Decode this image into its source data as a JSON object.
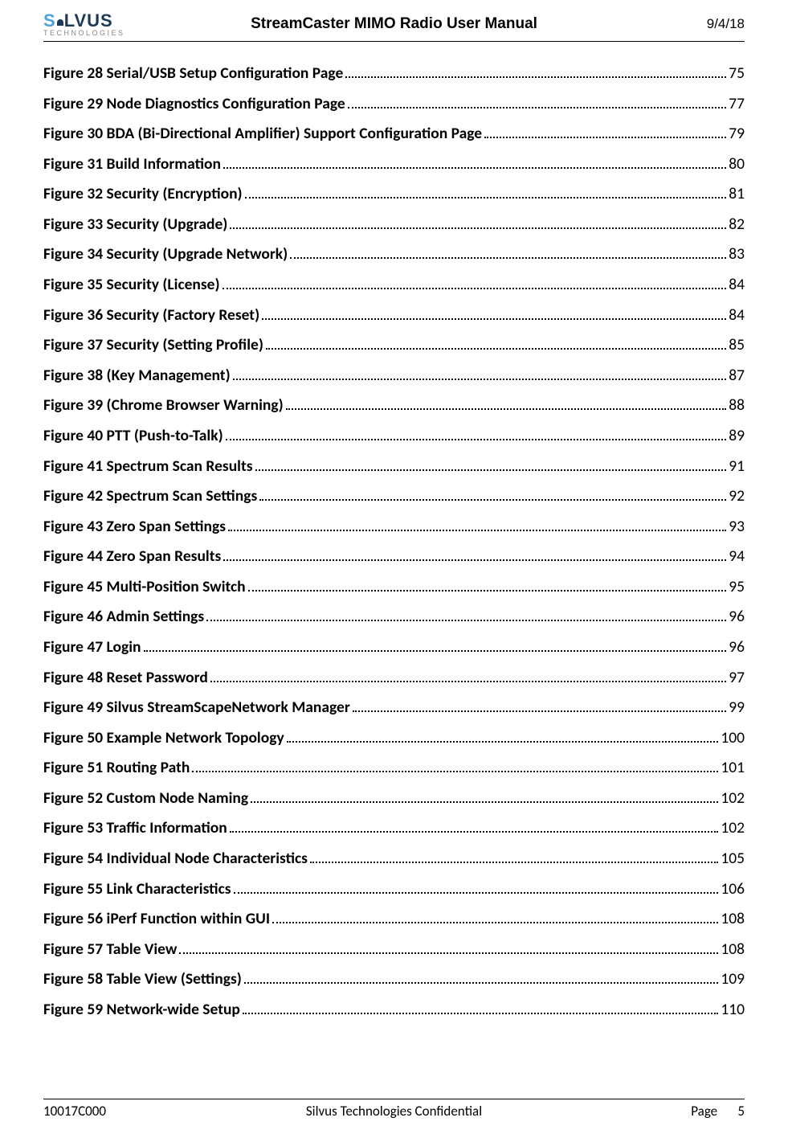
{
  "header": {
    "logo_brand_initial": "S",
    "logo_brand_rest": "LVUS",
    "logo_sub": "TECHNOLOGIES",
    "title": "StreamCaster MIMO Radio User Manual",
    "date": "9/4/18"
  },
  "toc": [
    {
      "title": "Figure 28 Serial/USB Setup Configuration Page",
      "page": "75"
    },
    {
      "title": "Figure 29 Node Diagnostics Configuration Page",
      "page": "77"
    },
    {
      "title": "Figure 30 BDA (Bi-Directional Amplifier) Support Configuration Page",
      "page": "79"
    },
    {
      "title": "Figure 31 Build Information",
      "page": "80"
    },
    {
      "title": "Figure 32 Security (Encryption)",
      "page": "81"
    },
    {
      "title": "Figure 33 Security (Upgrade)",
      "page": "82"
    },
    {
      "title": "Figure 34 Security (Upgrade Network)",
      "page": "83"
    },
    {
      "title": "Figure 35 Security (License)",
      "page": "84"
    },
    {
      "title": "Figure 36 Security (Factory Reset)",
      "page": "84"
    },
    {
      "title": "Figure 37 Security (Setting Profile)",
      "page": "85"
    },
    {
      "title": "Figure 38 (Key Management)",
      "page": "87"
    },
    {
      "title": "Figure 39 (Chrome Browser Warning)",
      "page": "88"
    },
    {
      "title": "Figure 40 PTT (Push-to-Talk)",
      "page": "89"
    },
    {
      "title": "Figure 41 Spectrum Scan Results",
      "page": "91"
    },
    {
      "title": "Figure 42 Spectrum Scan Settings",
      "page": "92"
    },
    {
      "title": "Figure 43 Zero Span Settings",
      "page": "93"
    },
    {
      "title": "Figure 44 Zero Span Results",
      "page": "94"
    },
    {
      "title": "Figure 45 Multi-Position Switch",
      "page": "95"
    },
    {
      "title": "Figure 46 Admin Settings",
      "page": "96"
    },
    {
      "title": "Figure 47 Login",
      "page": "96"
    },
    {
      "title": "Figure 48 Reset Password",
      "page": "97"
    },
    {
      "title": "Figure 49 Silvus StreamScapeNetwork Manager",
      "page": "99"
    },
    {
      "title": "Figure 50 Example Network Topology",
      "page": "100"
    },
    {
      "title": "Figure 51 Routing Path",
      "page": "101"
    },
    {
      "title": "Figure 52 Custom Node Naming",
      "page": "102"
    },
    {
      "title": "Figure 53 Traffic Information",
      "page": "102"
    },
    {
      "title": "Figure 54 Individual Node Characteristics",
      "page": "105"
    },
    {
      "title": "Figure 55 Link Characteristics",
      "page": "106"
    },
    {
      "title": "Figure 56 iPerf Function within GUI",
      "page": "108"
    },
    {
      "title": "Figure 57 Table View",
      "page": "108"
    },
    {
      "title": "Figure 58 Table View (Settings)",
      "page": "109"
    },
    {
      "title": "Figure 59 Network-wide Setup",
      "page": "110"
    }
  ],
  "footer": {
    "doc_number": "10017C000",
    "center": "Silvus Technologies Confidential",
    "page_label": "Page",
    "page_number": "5"
  }
}
